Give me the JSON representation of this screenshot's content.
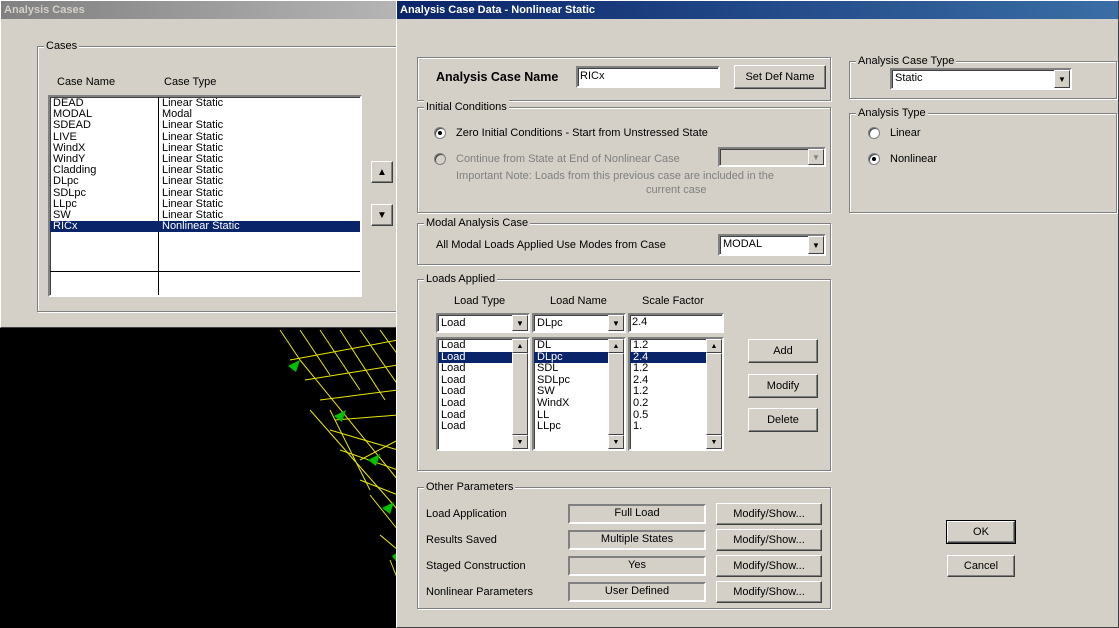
{
  "cases_window": {
    "title": "Analysis Cases",
    "group_label": "Cases",
    "col_name": "Case Name",
    "col_type": "Case Type",
    "rows": [
      {
        "name": "DEAD",
        "type": "Linear Static"
      },
      {
        "name": "MODAL",
        "type": "Modal"
      },
      {
        "name": "SDEAD",
        "type": "Linear Static"
      },
      {
        "name": "LIVE",
        "type": "Linear Static"
      },
      {
        "name": "WindX",
        "type": "Linear Static"
      },
      {
        "name": "WindY",
        "type": "Linear Static"
      },
      {
        "name": "Cladding",
        "type": "Linear Static"
      },
      {
        "name": "DLpc",
        "type": "Linear Static"
      },
      {
        "name": "SDLpc",
        "type": "Linear Static"
      },
      {
        "name": "LLpc",
        "type": "Linear Static"
      },
      {
        "name": "SW",
        "type": "Linear Static"
      },
      {
        "name": "RICx",
        "type": "Nonlinear Static"
      }
    ],
    "selected_index": 11
  },
  "dialog": {
    "title": "Analysis Case Data - Nonlinear Static",
    "case_name_label": "Analysis Case Name",
    "case_name_value": "RICx",
    "set_def_name_label": "Set Def Name",
    "initial_conditions": {
      "label": "Initial Conditions",
      "zero_label": "Zero Initial Conditions - Start from Unstressed State",
      "continue_label": "Continue from State at End of Nonlinear Case",
      "note_line1": "Important Note:   Loads from this previous case are included in the",
      "note_line2": "current case"
    },
    "modal": {
      "label": "Modal Analysis Case",
      "text": "All Modal Loads Applied Use Modes from Case",
      "value": "MODAL"
    },
    "loads": {
      "label": "Loads Applied",
      "col_type": "Load Type",
      "col_name": "Load Name",
      "col_scale": "Scale Factor",
      "sel_type": "Load",
      "sel_name": "DLpc",
      "sel_scale": "2.4",
      "types": [
        "Load",
        "Load",
        "Load",
        "Load",
        "Load",
        "Load",
        "Load",
        "Load"
      ],
      "names": [
        "DL",
        "DLpc",
        "SDL",
        "SDLpc",
        "SW",
        "WindX",
        "LL",
        "LLpc"
      ],
      "scales": [
        "1.2",
        "2.4",
        "1.2",
        "2.4",
        "1.2",
        "0.2",
        "0.5",
        "1."
      ],
      "selected_index": 1,
      "add_label": "Add",
      "modify_label": "Modify",
      "delete_label": "Delete"
    },
    "other": {
      "label": "Other Parameters",
      "rows": [
        {
          "label": "Load Application",
          "value": "Full Load",
          "button": "Modify/Show..."
        },
        {
          "label": "Results Saved",
          "value": "Multiple States",
          "button": "Modify/Show..."
        },
        {
          "label": "Staged Construction",
          "value": "Yes",
          "button": "Modify/Show..."
        },
        {
          "label": "Nonlinear Parameters",
          "value": "User Defined",
          "button": "Modify/Show..."
        }
      ]
    },
    "case_type": {
      "label": "Analysis Case Type",
      "value": "Static"
    },
    "analysis_type": {
      "label": "Analysis Type",
      "linear": "Linear",
      "nonlinear": "Nonlinear"
    },
    "ok_label": "OK",
    "cancel_label": "Cancel"
  },
  "colors": {
    "title_active": "#0a246a",
    "dialog_face": "#d4d0c8",
    "model_line": "#f0f000",
    "model_arrow": "#00c000"
  }
}
